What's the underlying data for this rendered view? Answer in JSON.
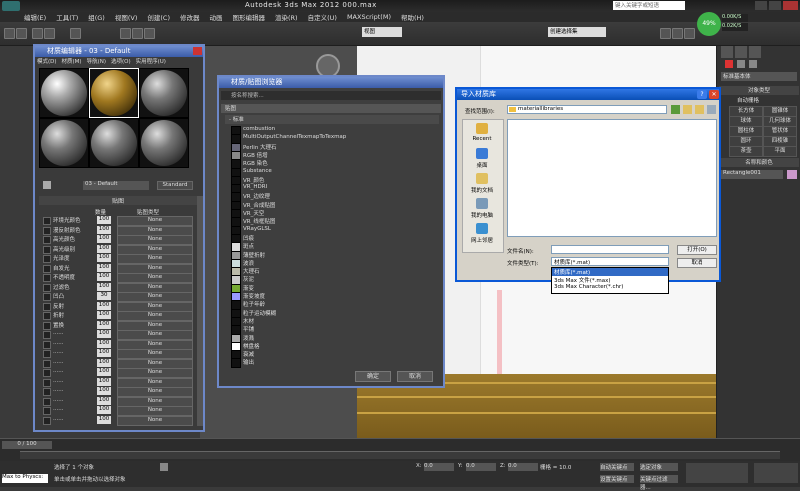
{
  "app": {
    "title": "Autodesk 3ds Max  2012      000.max",
    "search_placeholder": "键入关键字或短语"
  },
  "menu": [
    "编辑(E)",
    "工具(T)",
    "组(G)",
    "视图(V)",
    "创建(C)",
    "修改器",
    "动画",
    "图形编辑器",
    "渲染(R)",
    "自定义(U)",
    "MAXScript(M)",
    "帮助(H)"
  ],
  "stats": {
    "up": "0.00K/S",
    "down": "0.02K/S",
    "percent": "49%"
  },
  "toolbar": {
    "selection_set": "创建选择集",
    "viewport_label": "视图"
  },
  "command_panel": {
    "dropdown": "标准基本体",
    "rollout_object_type": "对象类型",
    "autogrid": "自动栅格",
    "buttons": [
      "长方体",
      "圆锥体",
      "球体",
      "几何球体",
      "圆柱体",
      "管状体",
      "圆环",
      "四棱锥",
      "茶壶",
      "平面"
    ],
    "rollout_name_color": "名称和颜色",
    "object_name": "Rectangle001"
  },
  "material_editor": {
    "title": "材质编辑器 - 03 - Default",
    "menu": [
      "模式(D)",
      "材质(M)",
      "导航(N)",
      "选项(O)",
      "实用程序(U)"
    ],
    "material_name": "03 - Default",
    "type_button": "Standard",
    "rollout": "贴图",
    "col_amount": "数量",
    "col_maptype": "贴图类型",
    "slots": [
      {
        "label": "环境光颜色",
        "amount": "100"
      },
      {
        "label": "漫反射颜色",
        "amount": "100"
      },
      {
        "label": "高光颜色",
        "amount": "100"
      },
      {
        "label": "高光级别",
        "amount": "100"
      },
      {
        "label": "光泽度",
        "amount": "100"
      },
      {
        "label": "自发光",
        "amount": "100"
      },
      {
        "label": "不透明度",
        "amount": "100"
      },
      {
        "label": "过滤色",
        "amount": "100"
      },
      {
        "label": "凹凸",
        "amount": "30"
      },
      {
        "label": "反射",
        "amount": "100"
      },
      {
        "label": "折射",
        "amount": "100"
      },
      {
        "label": "置换",
        "amount": "100"
      },
      {
        "label": "......",
        "amount": "100"
      },
      {
        "label": "......",
        "amount": "100"
      },
      {
        "label": "......",
        "amount": "100"
      },
      {
        "label": "......",
        "amount": "100"
      },
      {
        "label": "......",
        "amount": "100"
      },
      {
        "label": "......",
        "amount": "100"
      },
      {
        "label": "......",
        "amount": "100"
      },
      {
        "label": "......",
        "amount": "100"
      },
      {
        "label": "......",
        "amount": "100"
      },
      {
        "label": "......",
        "amount": "100"
      }
    ],
    "none_label": "None"
  },
  "browser": {
    "title": "材质/贴图浏览器",
    "search_placeholder": "按名称搜索...",
    "category": "贴图",
    "subcategory": "- 标准",
    "items": [
      "combustion",
      "MultiOutputChannelTexmapToTexmap",
      "Perlin 大理石",
      "RGB 倍增",
      "RGB 染色",
      "Substance",
      "VR_颜色",
      "VR_HDRI",
      "VR_边纹理",
      "VR_合成贴图",
      "VR_天空",
      "VR_线框贴图",
      "VRayGLSL",
      "凹痕",
      "斑点",
      "薄壁折射",
      "波浪",
      "大理石",
      "灰泥",
      "渐变",
      "渐变坡度",
      "粒子年龄",
      "粒子运动模糊",
      "木材",
      "平铺",
      "泼溅",
      "棋盘格",
      "衰减",
      "输出"
    ],
    "ok": "确定",
    "cancel": "取消"
  },
  "import_dialog": {
    "title": "导入材质库",
    "look_in_label": "查找范围(I):",
    "look_in_value": "materiallibraries",
    "places": [
      "Recent",
      "桌面",
      "我的文档",
      "我的电脑",
      "网上邻居"
    ],
    "filename_label": "文件名(N):",
    "filetype_label": "文件类型(T):",
    "filetype_value": "材质库(*.mat)",
    "open": "打开(O)",
    "cancel": "取消",
    "dropdown_options": [
      "材质库(*.mat)",
      "3ds Max 文件(*.max)",
      "3ds Max Character(*.chr)"
    ]
  },
  "timeline": {
    "frame": "0 / 100"
  },
  "status": {
    "maxscript": "Max to Physcs:",
    "selection": "选择了 1 个对象",
    "prompt": "单击或单击并拖动以选择对象",
    "x_label": "X:",
    "x": "0.0",
    "y_label": "Y:",
    "y": "0.0",
    "z_label": "Z:",
    "z": "0.0",
    "grid": "栅格 = 10.0",
    "autokey": "自动关键点",
    "selected": "选定对象",
    "setkey": "设置关键点",
    "filters": "关键点过滤器..."
  }
}
